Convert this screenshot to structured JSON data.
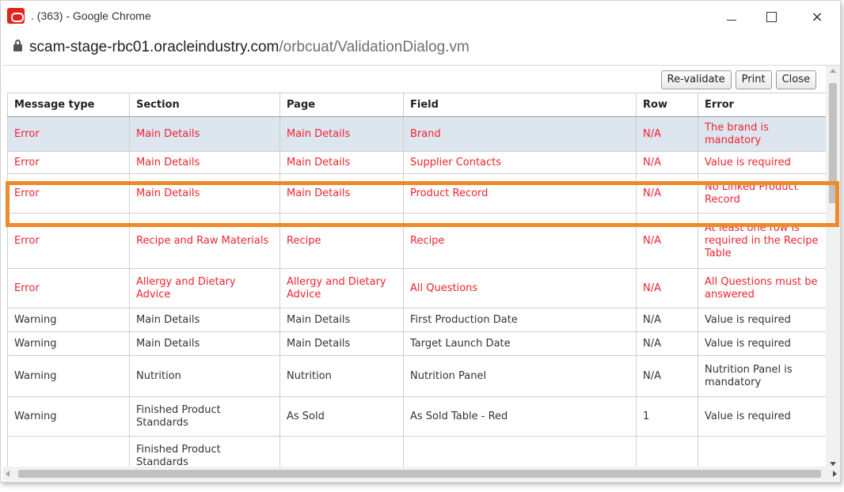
{
  "window": {
    "title": ". (363) - Google Chrome",
    "controls": {
      "minimize": "minimize",
      "maximize": "maximize",
      "close": "×"
    }
  },
  "address": {
    "domain": "scam-stage-rbc01.oracleindustry.com",
    "path": "/orbcuat/ValidationDialog.vm"
  },
  "toolbar": {
    "revalidate": "Re-validate",
    "print": "Print",
    "close": "Close"
  },
  "table": {
    "headers": [
      "Message type",
      "Section",
      "Page",
      "Field",
      "Row",
      "Error"
    ],
    "rows": [
      {
        "type": "Error",
        "section": "Main Details",
        "page": "Main Details",
        "field": "Brand",
        "row": "N/A",
        "error": "The brand is mandatory"
      },
      {
        "type": "Error",
        "section": "Main Details",
        "page": "Main Details",
        "field": "Supplier Contacts",
        "row": "N/A",
        "error": "Value is required"
      },
      {
        "type": "Error",
        "section": "Main Details",
        "page": "Main Details",
        "field": "Product Record",
        "row": "N/A",
        "error": "No Linked Product Record"
      },
      {
        "type": "Error",
        "section": "Recipe and Raw Materials",
        "page": "Recipe",
        "field": "Recipe",
        "row": "N/A",
        "error": "At least one row is required in the Recipe Table"
      },
      {
        "type": "Error",
        "section": "Allergy and Dietary Advice",
        "page": "Allergy and Dietary Advice",
        "field": "All Questions",
        "row": "N/A",
        "error": "All Questions must be answered"
      },
      {
        "type": "Warning",
        "section": "Main Details",
        "page": "Main Details",
        "field": "First Production Date",
        "row": "N/A",
        "error": "Value is required"
      },
      {
        "type": "Warning",
        "section": "Main Details",
        "page": "Main Details",
        "field": "Target Launch Date",
        "row": "N/A",
        "error": "Value is required"
      },
      {
        "type": "Warning",
        "section": "Nutrition",
        "page": "Nutrition",
        "field": "Nutrition Panel",
        "row": "N/A",
        "error": "Nutrition Panel is mandatory"
      },
      {
        "type": "Warning",
        "section": "Finished Product Standards",
        "page": "As Sold",
        "field": "As Sold Table - Red",
        "row": "1",
        "error": "Value is required"
      },
      {
        "type": "",
        "section": "Finished Product Standards",
        "page": "",
        "field": "",
        "row": "",
        "error": ""
      }
    ]
  },
  "colors": {
    "error_text": "#ee2430",
    "selected_row": "#dde5ef",
    "highlight_border": "#ef8a2a"
  },
  "icons": {
    "app": "oracle-logo-icon",
    "lock": "lock-icon"
  }
}
